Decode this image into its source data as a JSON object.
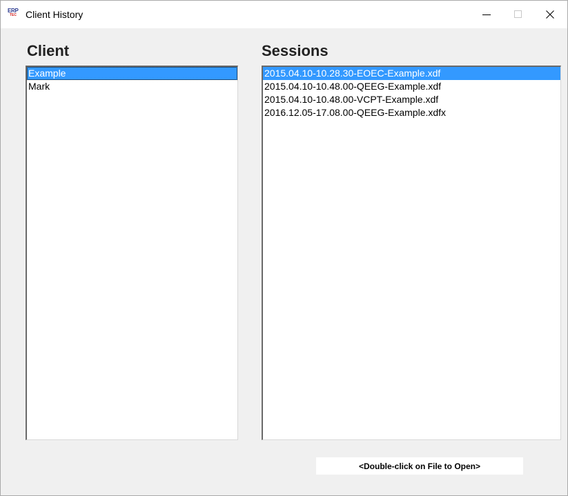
{
  "window": {
    "title": "Client History",
    "icon_name": "erp-app-icon",
    "icon_text": "ERP",
    "icon_subtext": "TEC"
  },
  "titlebar_buttons": {
    "minimize": "minimize-icon",
    "maximize": "maximize-icon",
    "close": "close-icon"
  },
  "client": {
    "heading": "Client",
    "items": [
      {
        "label": "Example",
        "selected": true
      },
      {
        "label": "Mark",
        "selected": false
      }
    ]
  },
  "sessions": {
    "heading": "Sessions",
    "items": [
      {
        "label": "2015.04.10-10.28.30-EOEC-Example.xdf",
        "selected": true
      },
      {
        "label": "2015.04.10-10.48.00-QEEG-Example.xdf",
        "selected": false
      },
      {
        "label": "2015.04.10-10.48.00-VCPT-Example.xdf",
        "selected": false
      },
      {
        "label": "2016.12.05-17.08.00-QEEG-Example.xdfx",
        "selected": false
      }
    ]
  },
  "hint": "<Double-click on File to Open>",
  "colors": {
    "selection": "#3399ff",
    "window_bg": "#f0f0f0",
    "titlebar_bg": "#ffffff"
  }
}
